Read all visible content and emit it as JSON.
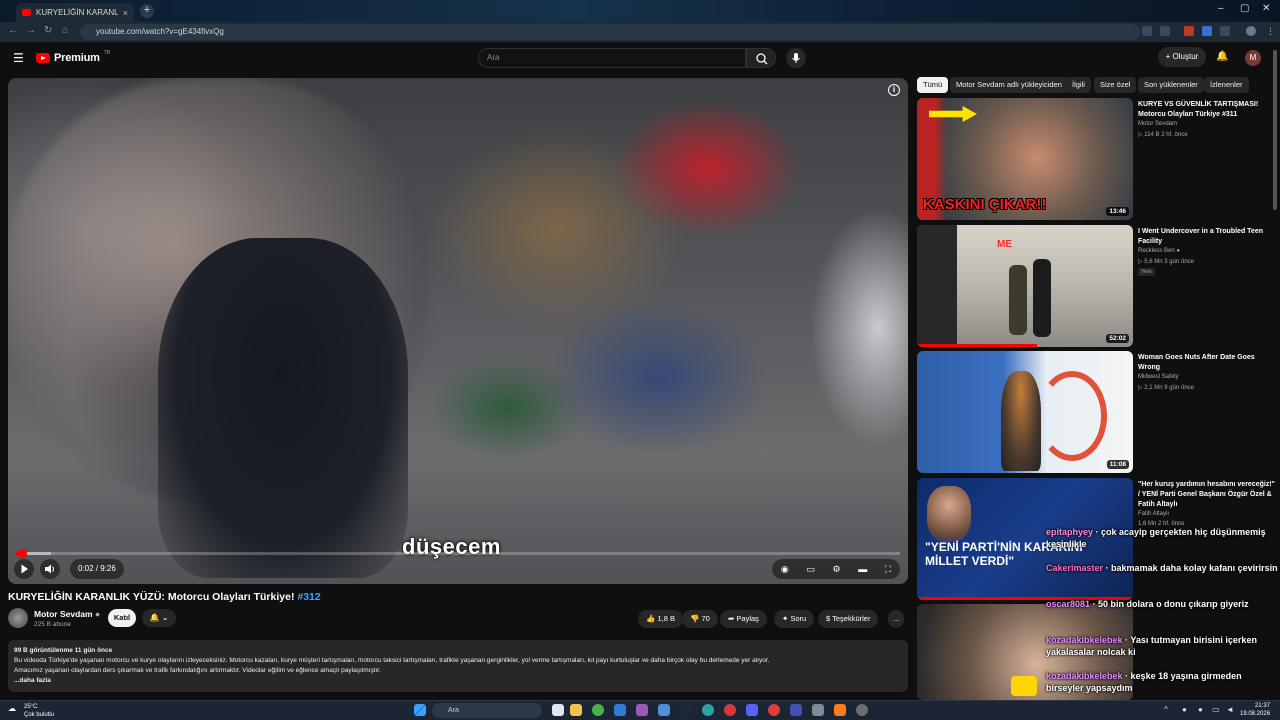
{
  "browser": {
    "tab_title": "KURYELİĞİN KARANLIK YÜZÜ...",
    "url": "youtube.com/watch?v=gE434fivxQg"
  },
  "header": {
    "logo_text": "Premium",
    "logo_region": "TR",
    "search_placeholder": "Ara",
    "create_label": "Oluştur",
    "avatar_letter": "M"
  },
  "player": {
    "subtitle": "düşecem",
    "time_current": "0:02",
    "time_total": "9:26",
    "progress_played": 0.004,
    "progress_buffered": 0.04
  },
  "video": {
    "title": "KURYELİĞİN KARANLIK YÜZÜ: Motorcu Olayları Türkiye!",
    "title_tag": "#312",
    "channel_name": "Motor Sevdam",
    "subscribers": "225 B abone",
    "join_label": "Katıl",
    "likes": "1,8 B",
    "dislikes": "70",
    "share_label": "Paylaş",
    "ask_label": "Soru",
    "thanks_label": "Teşekkürler",
    "more_label": "..."
  },
  "description": {
    "stats": "99 B görüntülenme  11 gün önce",
    "line1": "Bu videoda Türkiye'de yaşanan motorcu ve kurye olaylarını izleyeceksiniz. Motorcu kazaları, kurye müşteri tartışmaları, motorcu taksici tartışmaları, trafikte yaşanan gerginlikler, yol verme tartışmaları, kıl payı kurtuluşlar ve daha birçok olay bu derlemede yer alıyor.",
    "line2": "Amacımız yaşanan olaylardan ders çıkarmak ve trafik farkındalığını artırmaktır. Videolar eğitim ve eğlence amaçlı paylaşılmıştır.",
    "more": "...daha fazla"
  },
  "chips": [
    "Tümü",
    "Motor Sevdam adlı yükleyiciden",
    "İlgili",
    "Size özel",
    "Son yüklenenler",
    "İzlenenler"
  ],
  "recommendations": [
    {
      "title": "KURYE VS GÜVENLİK TARTIŞMASI! Motorcu Olayları Türkiye #311",
      "channel": "Motor Sevdam",
      "meta": "114 B  2 hf. önce",
      "duration": "13:46",
      "thumb_text": "KASKINI ÇIKAR!!"
    },
    {
      "title": "I Went Undercover in a Troubled Teen Facility",
      "channel": "Reckless Ben",
      "meta": "5,6 Mn  3 gün önce",
      "badge": "Yeni",
      "duration": "52:02",
      "thumb_text": "ME"
    },
    {
      "title": "Woman Goes Nuts After Date Goes Wrong",
      "channel": "Midwest Safety",
      "meta": "2,1 Mn  9 gün önce",
      "duration": "11:08"
    },
    {
      "title": "\"Her kuruş yardımın hesabını vereceğiz!\" / YENİ Parti Genel Başkanı Özgür Özel & Fatih Altaylı",
      "channel": "Fatih Altaylı",
      "meta": "1,6 Mn  2 hf. önce",
      "thumb_text": "\"YENİ PARTİ'NİN KARARINI MİLLET VERDİ\""
    }
  ],
  "chat": [
    {
      "user": "epitaphyey",
      "text": "çok acayip gerçekten hiç düşünmemiş kesinlikle"
    },
    {
      "user": "Cakerimaster",
      "text": "bakmamak daha kolay kafanı çevirirsin"
    },
    {
      "user": "oscar8081",
      "text": "50 bin dolara o donu çıkarıp giyeriz"
    },
    {
      "user": "kozadakibkelebek",
      "text": "Yası tutmayan birisini içerken yakalasalar nolcak ki"
    },
    {
      "user": "kozadakibkelebek",
      "text": "keşke 18 yaşına girmeden birseyler yapsaydım"
    }
  ],
  "taskbar": {
    "temp": "25°C",
    "weather": "Çok bulutlu",
    "search": "Ara",
    "time": "21:37",
    "date": "19.08.2026"
  },
  "colors": {
    "accent": "#ff0000",
    "link": "#3ea6ff",
    "background": "#0f0f0f"
  }
}
